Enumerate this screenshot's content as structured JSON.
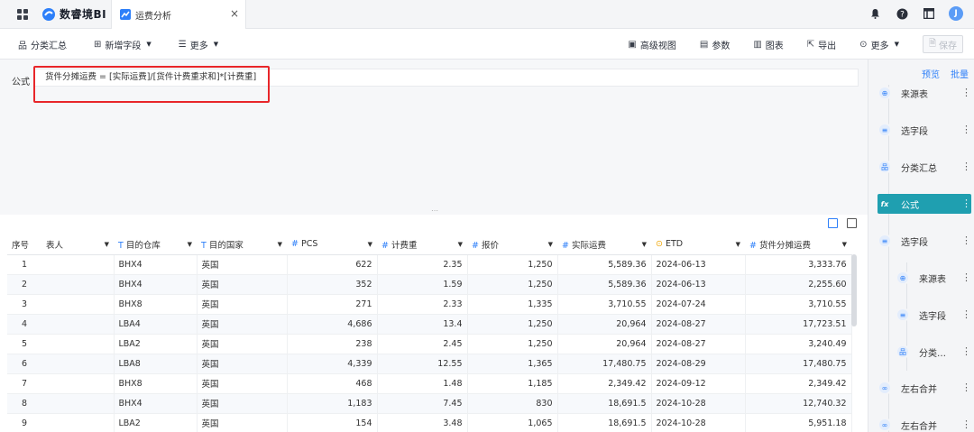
{
  "app": {
    "logo_text": "数睿境BI",
    "tab_title": "运费分析",
    "tab_close": "×",
    "avatar_initial": "J"
  },
  "toolbar": {
    "left": [
      {
        "label": "分类汇总",
        "icon": "hierarchy-icon"
      },
      {
        "label": "新增字段",
        "icon": "add-field-icon",
        "dropdown": true
      },
      {
        "label": "更多",
        "icon": "list-icon",
        "dropdown": true
      }
    ],
    "right": [
      {
        "label": "高级视图",
        "icon": "view-icon"
      },
      {
        "label": "参数",
        "icon": "param-icon"
      },
      {
        "label": "图表",
        "icon": "chart-icon"
      },
      {
        "label": "导出",
        "icon": "export-icon"
      },
      {
        "label": "更多",
        "icon": "more-icon",
        "dropdown": true
      }
    ],
    "save_label": "保存"
  },
  "formula": {
    "label": "公式",
    "expression": "货件分摊运费 = [实际运费]/[货件计费重求和]*[计费重]"
  },
  "table": {
    "columns": [
      {
        "label": "序号",
        "type": ""
      },
      {
        "label": "表人",
        "type": "",
        "dropdown": true
      },
      {
        "label": "目的仓库",
        "type": "T",
        "dropdown": true
      },
      {
        "label": "目的国家",
        "type": "T",
        "dropdown": true
      },
      {
        "label": "PCS",
        "type": "#",
        "dropdown": true
      },
      {
        "label": "计费重",
        "type": "#",
        "dropdown": true
      },
      {
        "label": "报价",
        "type": "#",
        "dropdown": true
      },
      {
        "label": "实际运费",
        "type": "#",
        "dropdown": true
      },
      {
        "label": "ETD",
        "type": "date",
        "dropdown": true
      },
      {
        "label": "货件分摊运费",
        "type": "#",
        "dropdown": true
      }
    ],
    "rows": [
      [
        "1",
        "",
        "BHX4",
        "英国",
        "622",
        "2.35",
        "1,250",
        "5,589.36",
        "2024-06-13",
        "3,333.76"
      ],
      [
        "2",
        "",
        "BHX4",
        "英国",
        "352",
        "1.59",
        "1,250",
        "5,589.36",
        "2024-06-13",
        "2,255.60"
      ],
      [
        "3",
        "",
        "BHX8",
        "英国",
        "271",
        "2.33",
        "1,335",
        "3,710.55",
        "2024-07-24",
        "3,710.55"
      ],
      [
        "4",
        "",
        "LBA4",
        "英国",
        "4,686",
        "13.4",
        "1,250",
        "20,964",
        "2024-08-27",
        "17,723.51"
      ],
      [
        "5",
        "",
        "LBA2",
        "英国",
        "238",
        "2.45",
        "1,250",
        "20,964",
        "2024-08-27",
        "3,240.49"
      ],
      [
        "6",
        "",
        "LBA8",
        "英国",
        "4,339",
        "12.55",
        "1,365",
        "17,480.75",
        "2024-08-29",
        "17,480.75"
      ],
      [
        "7",
        "",
        "BHX8",
        "英国",
        "468",
        "1.48",
        "1,185",
        "2,349.42",
        "2024-09-12",
        "2,349.42"
      ],
      [
        "8",
        "",
        "BHX4",
        "英国",
        "1,183",
        "7.45",
        "830",
        "18,691.5",
        "2024-10-28",
        "12,740.32"
      ],
      [
        "9",
        "",
        "LBA2",
        "英国",
        "154",
        "3.48",
        "1,065",
        "18,691.5",
        "2024-10-28",
        "5,951.18"
      ]
    ]
  },
  "right_panel": {
    "preview_link": "预览",
    "batch_link": "批量",
    "nodes": [
      {
        "label": "来源表",
        "icon": "source-table-icon",
        "glyph": "⊕",
        "level": 0,
        "active": false
      },
      {
        "label": "选字段",
        "icon": "select-field-icon",
        "glyph": "≡",
        "level": 0,
        "active": false
      },
      {
        "label": "分类汇总",
        "icon": "hierarchy-icon",
        "glyph": "品",
        "level": 0,
        "active": false
      },
      {
        "label": "公式",
        "icon": "formula-icon",
        "glyph": "fx",
        "level": 0,
        "active": true
      },
      {
        "label": "选字段",
        "icon": "select-field-icon",
        "glyph": "≡",
        "level": 0,
        "active": false
      },
      {
        "label": "来源表",
        "icon": "source-table-icon",
        "glyph": "⊕",
        "level": 1,
        "active": false
      },
      {
        "label": "选字段",
        "icon": "select-field-icon",
        "glyph": "≡",
        "level": 1,
        "active": false
      },
      {
        "label": "分类…",
        "icon": "hierarchy-icon",
        "glyph": "品",
        "level": 1,
        "active": false
      },
      {
        "label": "左右合并",
        "icon": "merge-icon",
        "glyph": "∞",
        "level": 0,
        "active": false
      },
      {
        "label": "左右合并",
        "icon": "merge-icon",
        "glyph": "∞",
        "level": 0,
        "active": false
      }
    ],
    "more_glyph": "⋮"
  },
  "colors": {
    "accent": "#2d7ff9",
    "active_node": "#1f9fb0",
    "highlight_border": "#e8262a"
  }
}
